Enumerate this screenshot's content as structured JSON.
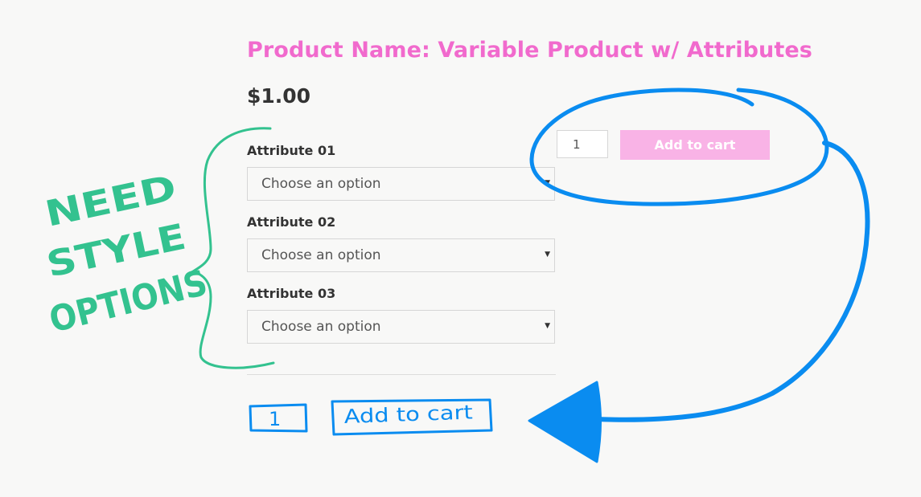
{
  "product": {
    "title": "Product Name: Variable Product w/ Attributes",
    "price": "$1.00"
  },
  "attributes": [
    {
      "label": "Attribute 01",
      "placeholder": "Choose an option"
    },
    {
      "label": "Attribute 02",
      "placeholder": "Choose an option"
    },
    {
      "label": "Attribute 03",
      "placeholder": "Choose an option"
    }
  ],
  "cart": {
    "quantity": "1",
    "button_label": "Add to cart"
  },
  "annotations": {
    "note_lines": [
      "NEED",
      "STYLE",
      "OPTIONS"
    ],
    "sketch_quantity": "1",
    "sketch_button_label": "Add to cart",
    "colors": {
      "green": "#33c28f",
      "blue": "#0a8cf0",
      "accent_pink": "#f16acd"
    }
  }
}
